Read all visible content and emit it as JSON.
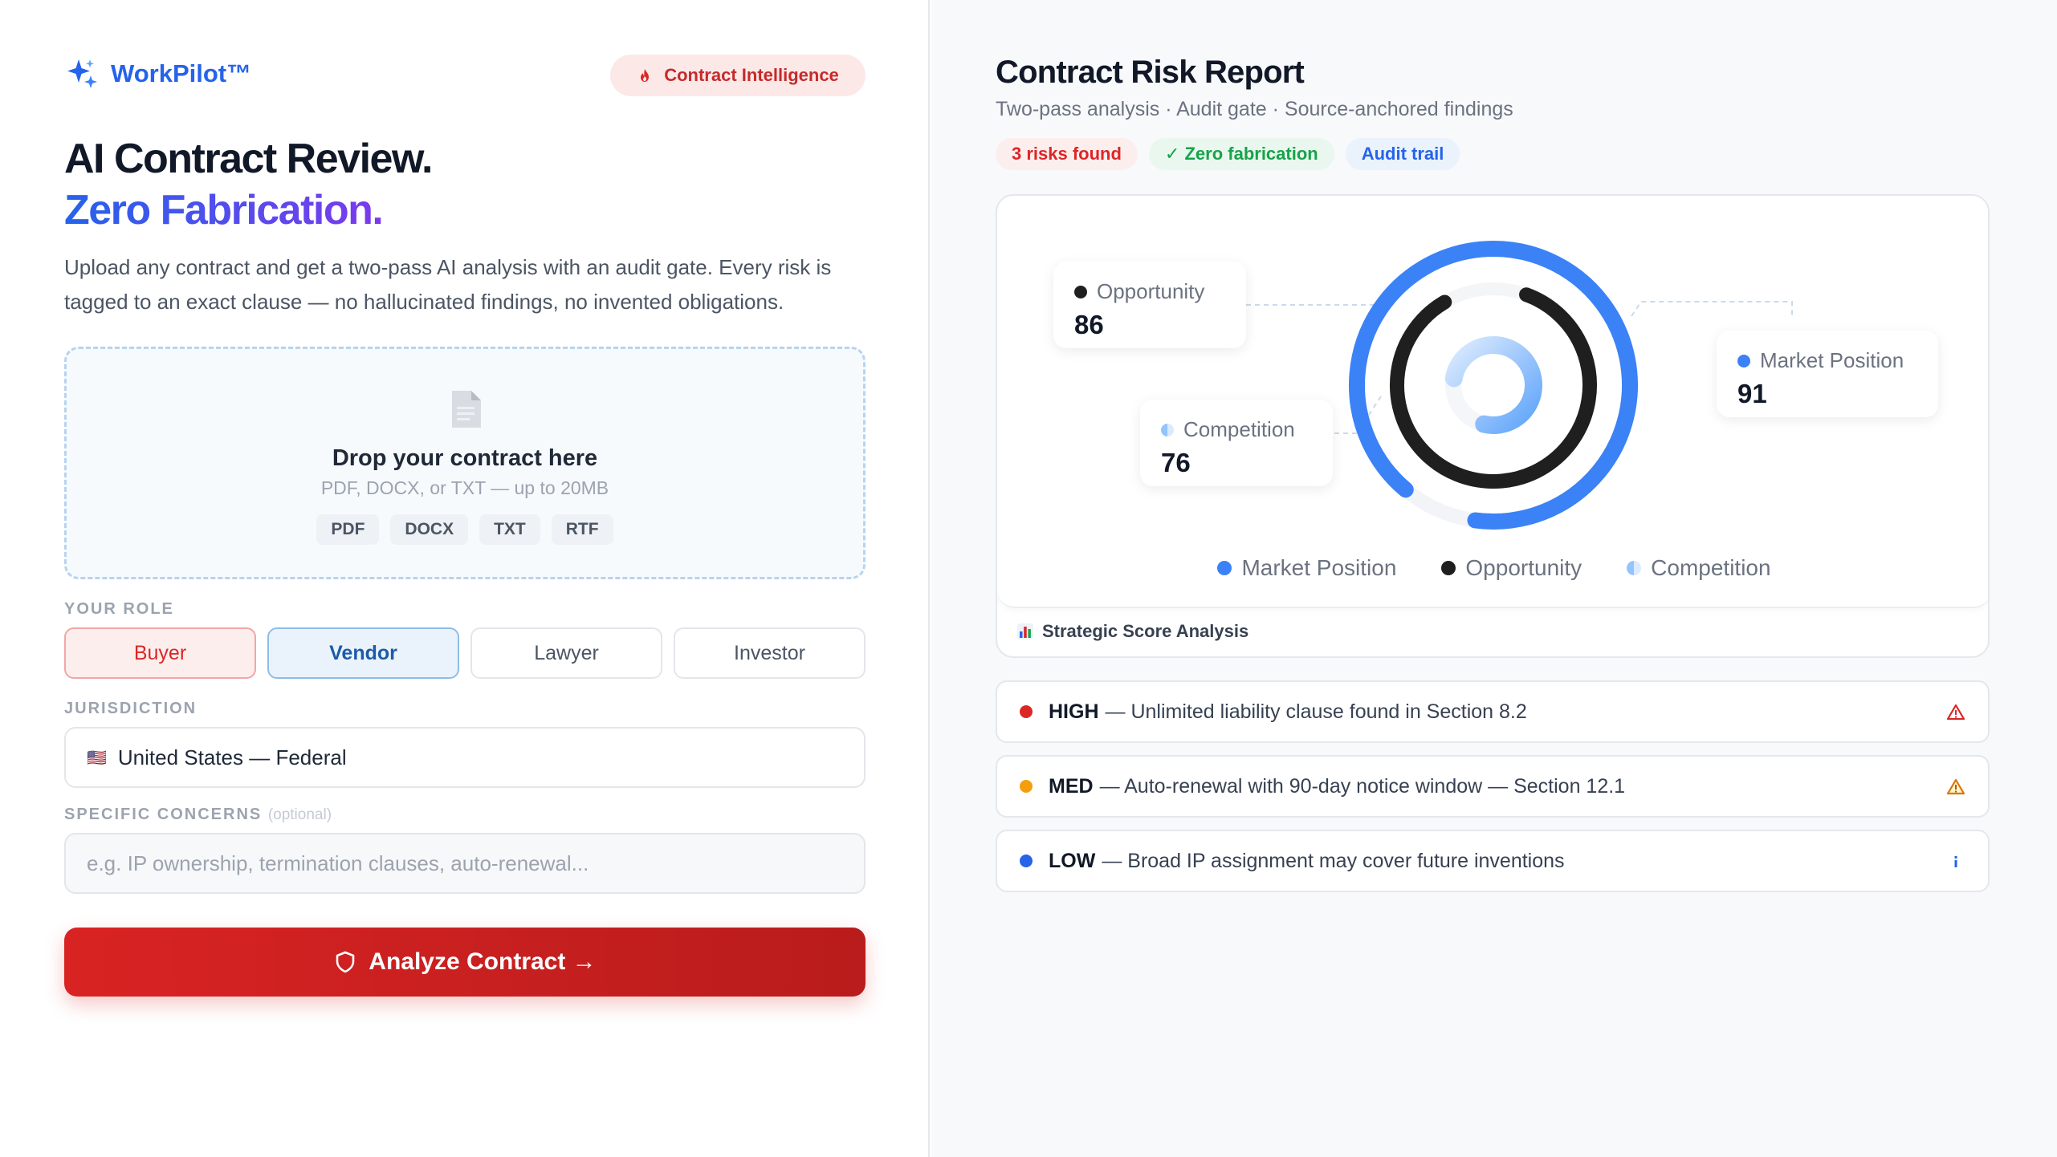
{
  "brand": {
    "name": "WorkPilot™",
    "pill": "Contract Intelligence"
  },
  "hero": {
    "line1": "AI Contract Review.",
    "line2": "Zero Fabrication.",
    "description": "Upload any contract and get a two-pass AI analysis with an audit gate. Every risk is tagged to an exact clause — no hallucinated findings, no invented obligations."
  },
  "upload": {
    "title": "Drop your contract here",
    "subtitle": "PDF, DOCX, or TXT — up to 20MB",
    "formats": [
      "PDF",
      "DOCX",
      "TXT",
      "RTF"
    ]
  },
  "form": {
    "role_label": "YOUR ROLE",
    "roles": [
      "Buyer",
      "Vendor",
      "Lawyer",
      "Investor"
    ],
    "jurisdiction_label": "JURISDICTION",
    "jurisdiction_flag": "🇺🇸",
    "jurisdiction_value": "United States — Federal",
    "concerns_label": "SPECIFIC CONCERNS",
    "concerns_optional": "(optional)",
    "concerns_placeholder": "e.g. IP ownership, termination clauses, auto-renewal..."
  },
  "analyze_button": "Analyze Contract →",
  "report": {
    "title": "Contract Risk Report",
    "subtitle": "Two-pass analysis · Audit gate · Source-anchored findings",
    "badges": {
      "risks": "3 risks found",
      "zero": "✓ Zero fabrication",
      "audit": "Audit trail"
    },
    "card_footer": "Strategic Score Analysis"
  },
  "chart_data": {
    "type": "radial-bar",
    "series": [
      {
        "name": "Market Position",
        "value": 91,
        "color": "#3b82f6"
      },
      {
        "name": "Opportunity",
        "value": 86,
        "color": "#1f1f1f"
      },
      {
        "name": "Competition",
        "value": 76,
        "color": "#93c5fd"
      }
    ],
    "legend": "bottom"
  },
  "risks": [
    {
      "level": "HIGH",
      "text": "— Unlimited liability clause found in Section 8.2",
      "color": "#dc2626",
      "icon": "warning-triangle-icon"
    },
    {
      "level": "MED",
      "text": "— Auto-renewal with 90-day notice window — Section 12.1",
      "color": "#f59e0b",
      "icon": "warning-triangle-icon"
    },
    {
      "level": "LOW",
      "text": "— Broad IP assignment may cover future inventions",
      "color": "#2563eb",
      "icon": "info-icon"
    }
  ]
}
